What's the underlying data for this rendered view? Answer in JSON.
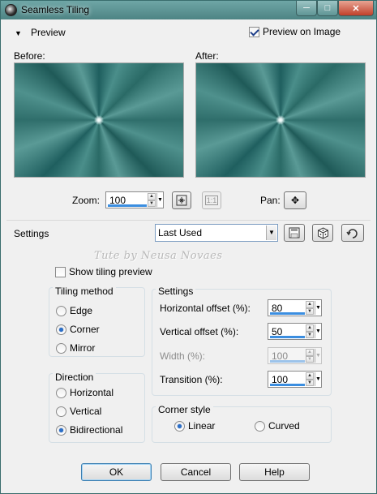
{
  "window": {
    "title": "Seamless Tiling"
  },
  "preview_section": {
    "label": "Preview",
    "preview_on_image_label": "Preview on Image",
    "preview_on_image_checked": true,
    "before_label": "Before:",
    "after_label": "After:",
    "zoom_label": "Zoom:",
    "zoom_value": "100",
    "pan_label": "Pan:",
    "fit_icon": "fit-to-window-icon",
    "actual_size_icon": "actual-size-icon",
    "pan_icon": "move-cross-icon"
  },
  "settings_bar": {
    "label": "Settings",
    "preset_value": "Last Used",
    "save_icon": "save-preset-icon",
    "random_icon": "randomize-dice-icon",
    "reset_icon": "reset-icon"
  },
  "watermark": "Tute by Neusa Novaes",
  "show_tiling_preview": {
    "label": "Show tiling preview",
    "checked": false
  },
  "tiling_method": {
    "title": "Tiling method",
    "options": [
      "Edge",
      "Corner",
      "Mirror"
    ],
    "selected": "Corner"
  },
  "direction": {
    "title": "Direction",
    "options": [
      "Horizontal",
      "Vertical",
      "Bidirectional"
    ],
    "selected": "Bidirectional"
  },
  "settings_group": {
    "title": "Settings",
    "horizontal_offset_label": "Horizontal offset (%):",
    "horizontal_offset_value": "80",
    "vertical_offset_label": "Vertical offset (%):",
    "vertical_offset_value": "50",
    "width_label": "Width (%):",
    "width_value": "100",
    "transition_label": "Transition (%):",
    "transition_value": "100"
  },
  "corner_style": {
    "title": "Corner style",
    "options": [
      "Linear",
      "Curved"
    ],
    "selected": "Linear"
  },
  "buttons": {
    "ok": "OK",
    "cancel": "Cancel",
    "help": "Help"
  },
  "colors": {
    "title_bar": "#4d8484",
    "close_button": "#c0402a",
    "focus_underline": "#3b8ee0"
  }
}
